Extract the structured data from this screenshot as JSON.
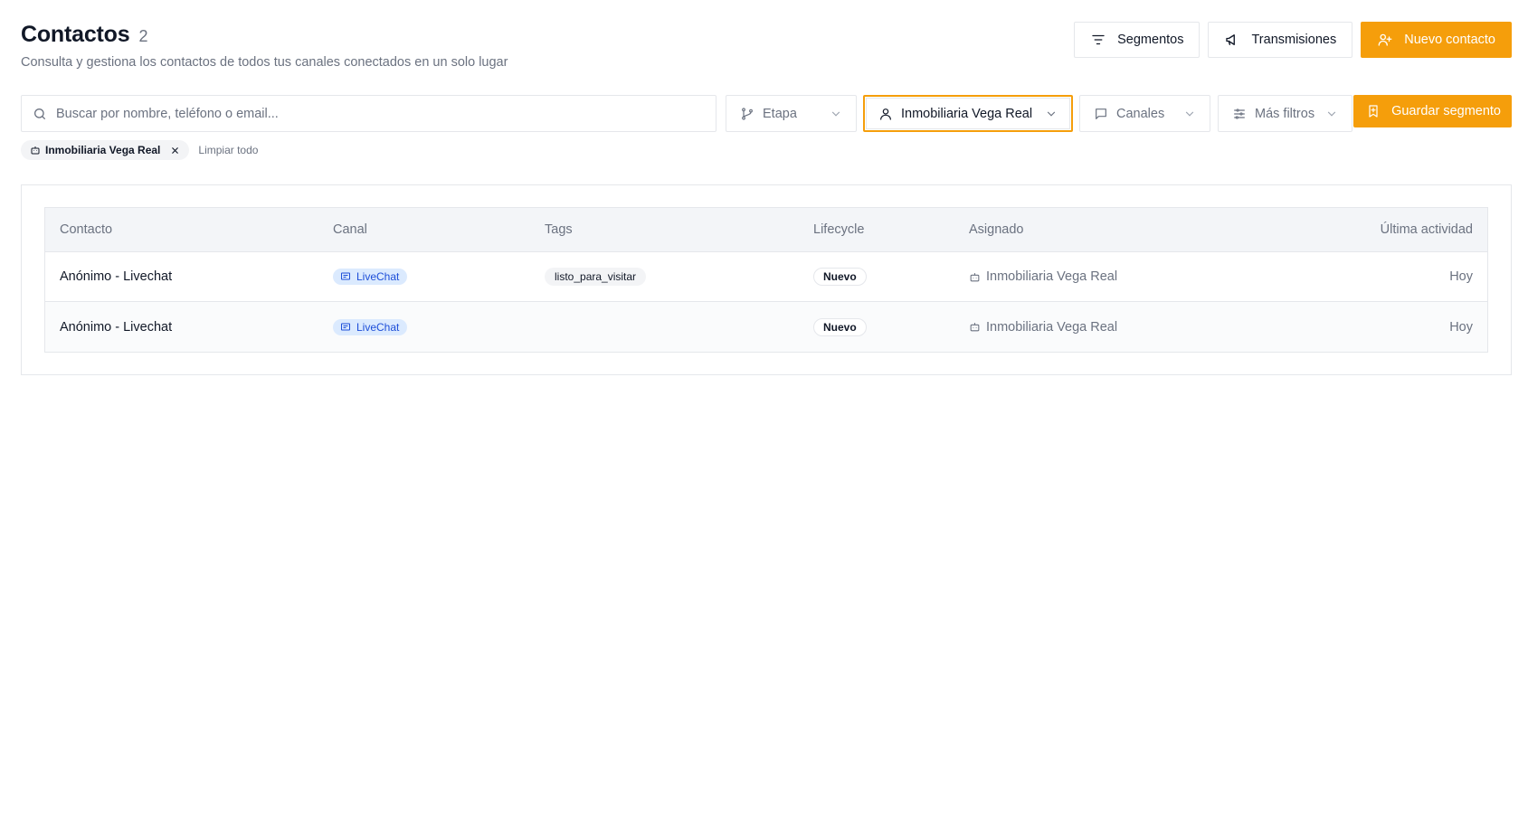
{
  "header": {
    "title": "Contactos",
    "count": "2",
    "subtitle": "Consulta y gestiona los contactos de todos tus canales conectados en un solo lugar"
  },
  "actions": {
    "segments_label": "Segmentos",
    "broadcasts_label": "Transmisiones",
    "new_contact_label": "Nuevo contacto"
  },
  "filters": {
    "search_placeholder": "Buscar por nombre, teléfono o email...",
    "stage_label": "Etapa",
    "agent_label": "Inmobiliaria Vega Real",
    "channels_label": "Canales",
    "more_filters_label": "Más filtros",
    "save_segment_label": "Guardar segmento"
  },
  "active_chips": {
    "chip_label": "Inmobiliaria Vega Real",
    "clear_label": "Limpiar todo"
  },
  "table": {
    "columns": [
      "Contacto",
      "Canal",
      "Tags",
      "Lifecycle",
      "Asignado",
      "Última actividad"
    ],
    "rows": [
      {
        "contact": "Anónimo - Livechat",
        "channel": "LiveChat",
        "tag": "listo_para_visitar",
        "lifecycle": "Nuevo",
        "assigned": "Inmobiliaria Vega Real",
        "last_activity": "Hoy"
      },
      {
        "contact": "Anónimo - Livechat",
        "channel": "LiveChat",
        "tag": "",
        "lifecycle": "Nuevo",
        "assigned": "Inmobiliaria Vega Real",
        "last_activity": "Hoy"
      }
    ]
  },
  "colors": {
    "accent": "#f59e0b",
    "livechat_badge_bg": "#dbeafe",
    "livechat_badge_text": "#1d4ed8"
  }
}
